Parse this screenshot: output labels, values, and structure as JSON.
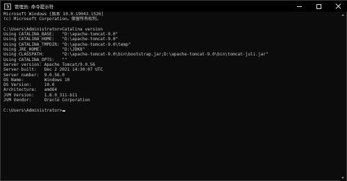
{
  "window": {
    "title": "管理员: 命令提示符",
    "controls": {
      "minimize": "minimize",
      "maximize": "maximize",
      "close": "close"
    }
  },
  "console": {
    "lines": [
      "Microsoft Windows [版本 10.0.19043.1526]",
      "(c) Microsoft Corporation。保留所有权利。",
      "",
      "C:\\Users\\Administrator>Catalina version",
      "Using CATALINA_BASE:   \"D:\\apache-tomcat-9.0\"",
      "Using CATALINA_HOME:   \"D:\\apache-tomcat-9.0\"",
      "Using CATALINA_TMPDIR: \"D:\\apache-tomcat-9.0\\temp\"",
      "Using JRE_HOME:        \"D:\\JDK8\"",
      "Using CLASSPATH:       \"D:\\apache-tomcat-9.0\\bin\\bootstrap.jar;D:\\apache-tomcat-9.0\\bin\\tomcat-juli.jar\"",
      "Using CATALINA_OPTS:   \"\"",
      "Server version: Apache Tomcat/9.0.56",
      "Server built:   Dec 2 2021 14:30:07 UTC",
      "Server number:  9.0.56.0",
      "OS Name:        Windows 10",
      "OS Version:     10.0",
      "Architecture:   amd64",
      "JVM Version:    1.8.0_311-b11",
      "JVM Vendor:     Oracle Corporation",
      "",
      "C:\\Users\\Administrator>"
    ]
  },
  "icons": {
    "title": "cmd-icon",
    "minimize": "minimize-icon",
    "maximize": "maximize-icon",
    "close": "close-icon"
  },
  "colors": {
    "background": "#0c0c0c",
    "text": "#cccccc",
    "titlebar": "#000000"
  }
}
